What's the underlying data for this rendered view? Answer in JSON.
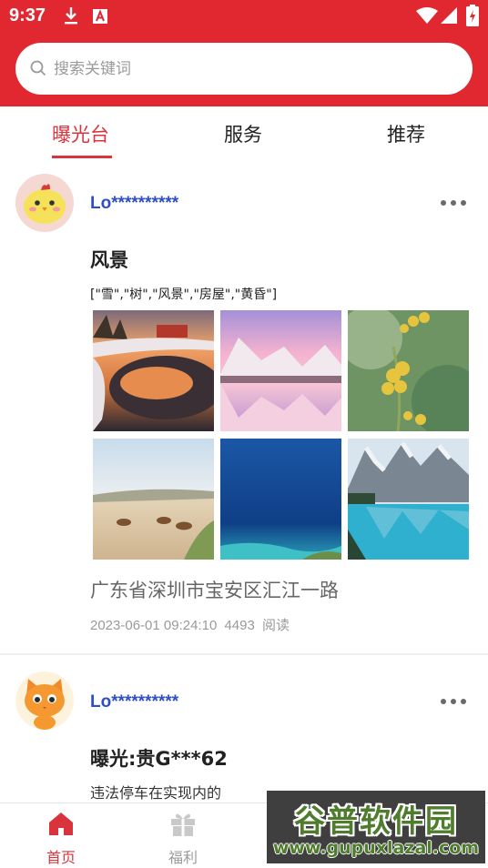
{
  "status_bar": {
    "time": "9:37",
    "left_icons": [
      "download-icon",
      "font-icon"
    ],
    "right_icons": [
      "wifi-icon",
      "signal-icon",
      "battery-icon"
    ]
  },
  "search": {
    "placeholder": "搜索关键词",
    "value": ""
  },
  "tabs": [
    {
      "label": "曝光台",
      "active": true
    },
    {
      "label": "服务",
      "active": false
    },
    {
      "label": "推荐",
      "active": false
    }
  ],
  "posts": [
    {
      "username": "Lo**********",
      "avatar_icon": "yellow-chick-avatar",
      "title": "风景",
      "tags": "[\"雪\",\"树\",\"风景\",\"房屋\",\"黄昏\"]",
      "photos": [
        "sunset-frozen-lake-photo",
        "pink-snowy-mountain-lake-photo",
        "yellow-flowers-photo",
        "desert-camels-photo",
        "blue-ocean-photo",
        "mountain-lake-photo"
      ],
      "location": "广东省深圳市宝安区汇江一路",
      "datetime": "2023-06-01 09:24:10",
      "views": "4493",
      "views_label": "阅读"
    },
    {
      "username": "Lo**********",
      "avatar_icon": "orange-cat-avatar",
      "title": "曝光:贵G***62",
      "description": "违法停车在实现内的"
    }
  ],
  "bottom_nav": [
    {
      "label": "首页",
      "icon": "home-icon",
      "active": true
    },
    {
      "label": "福利",
      "icon": "gift-icon",
      "active": false
    }
  ],
  "watermark": {
    "title": "谷普软件园",
    "url": "www.gupuxlazal.com"
  },
  "colors": {
    "brand_red": "#e1272f",
    "active_tab": "#d9343c",
    "username_blue": "#2f4ec5",
    "inactive_gray": "#9a9a9a"
  }
}
